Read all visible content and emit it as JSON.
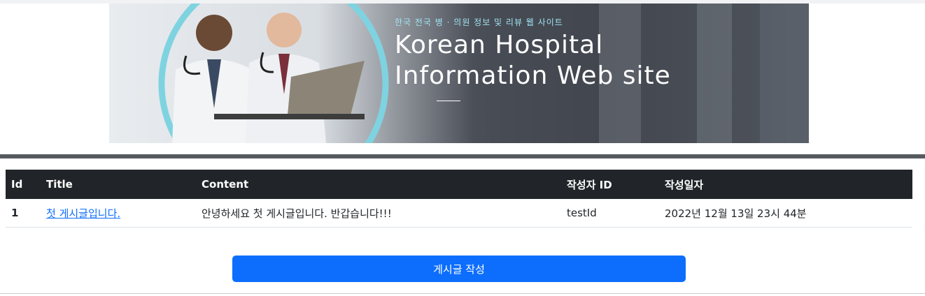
{
  "banner": {
    "subtitle": "한국 전국 병 · 의원 정보 및 리뷰 웹 사이트",
    "title_line1": "Korean Hospital",
    "title_line2": "Information Web site"
  },
  "table": {
    "headers": [
      "Id",
      "Title",
      "Content",
      "작성자 ID",
      "작성일자"
    ],
    "rows": [
      {
        "id": "1",
        "title": "첫 게시글입니다.",
        "content": "안녕하세요 첫 게시글입니다. 반갑습니다!!!",
        "author": "testId",
        "date": "2022년 12월 13일 23시 44분"
      }
    ]
  },
  "write_button": "게시글 작성",
  "colors": {
    "header_bg": "#212529",
    "button_bg": "#0d6efd",
    "link": "#0d6efd",
    "divider": "#555a5f",
    "banner_ring": "#7fd3e0"
  }
}
